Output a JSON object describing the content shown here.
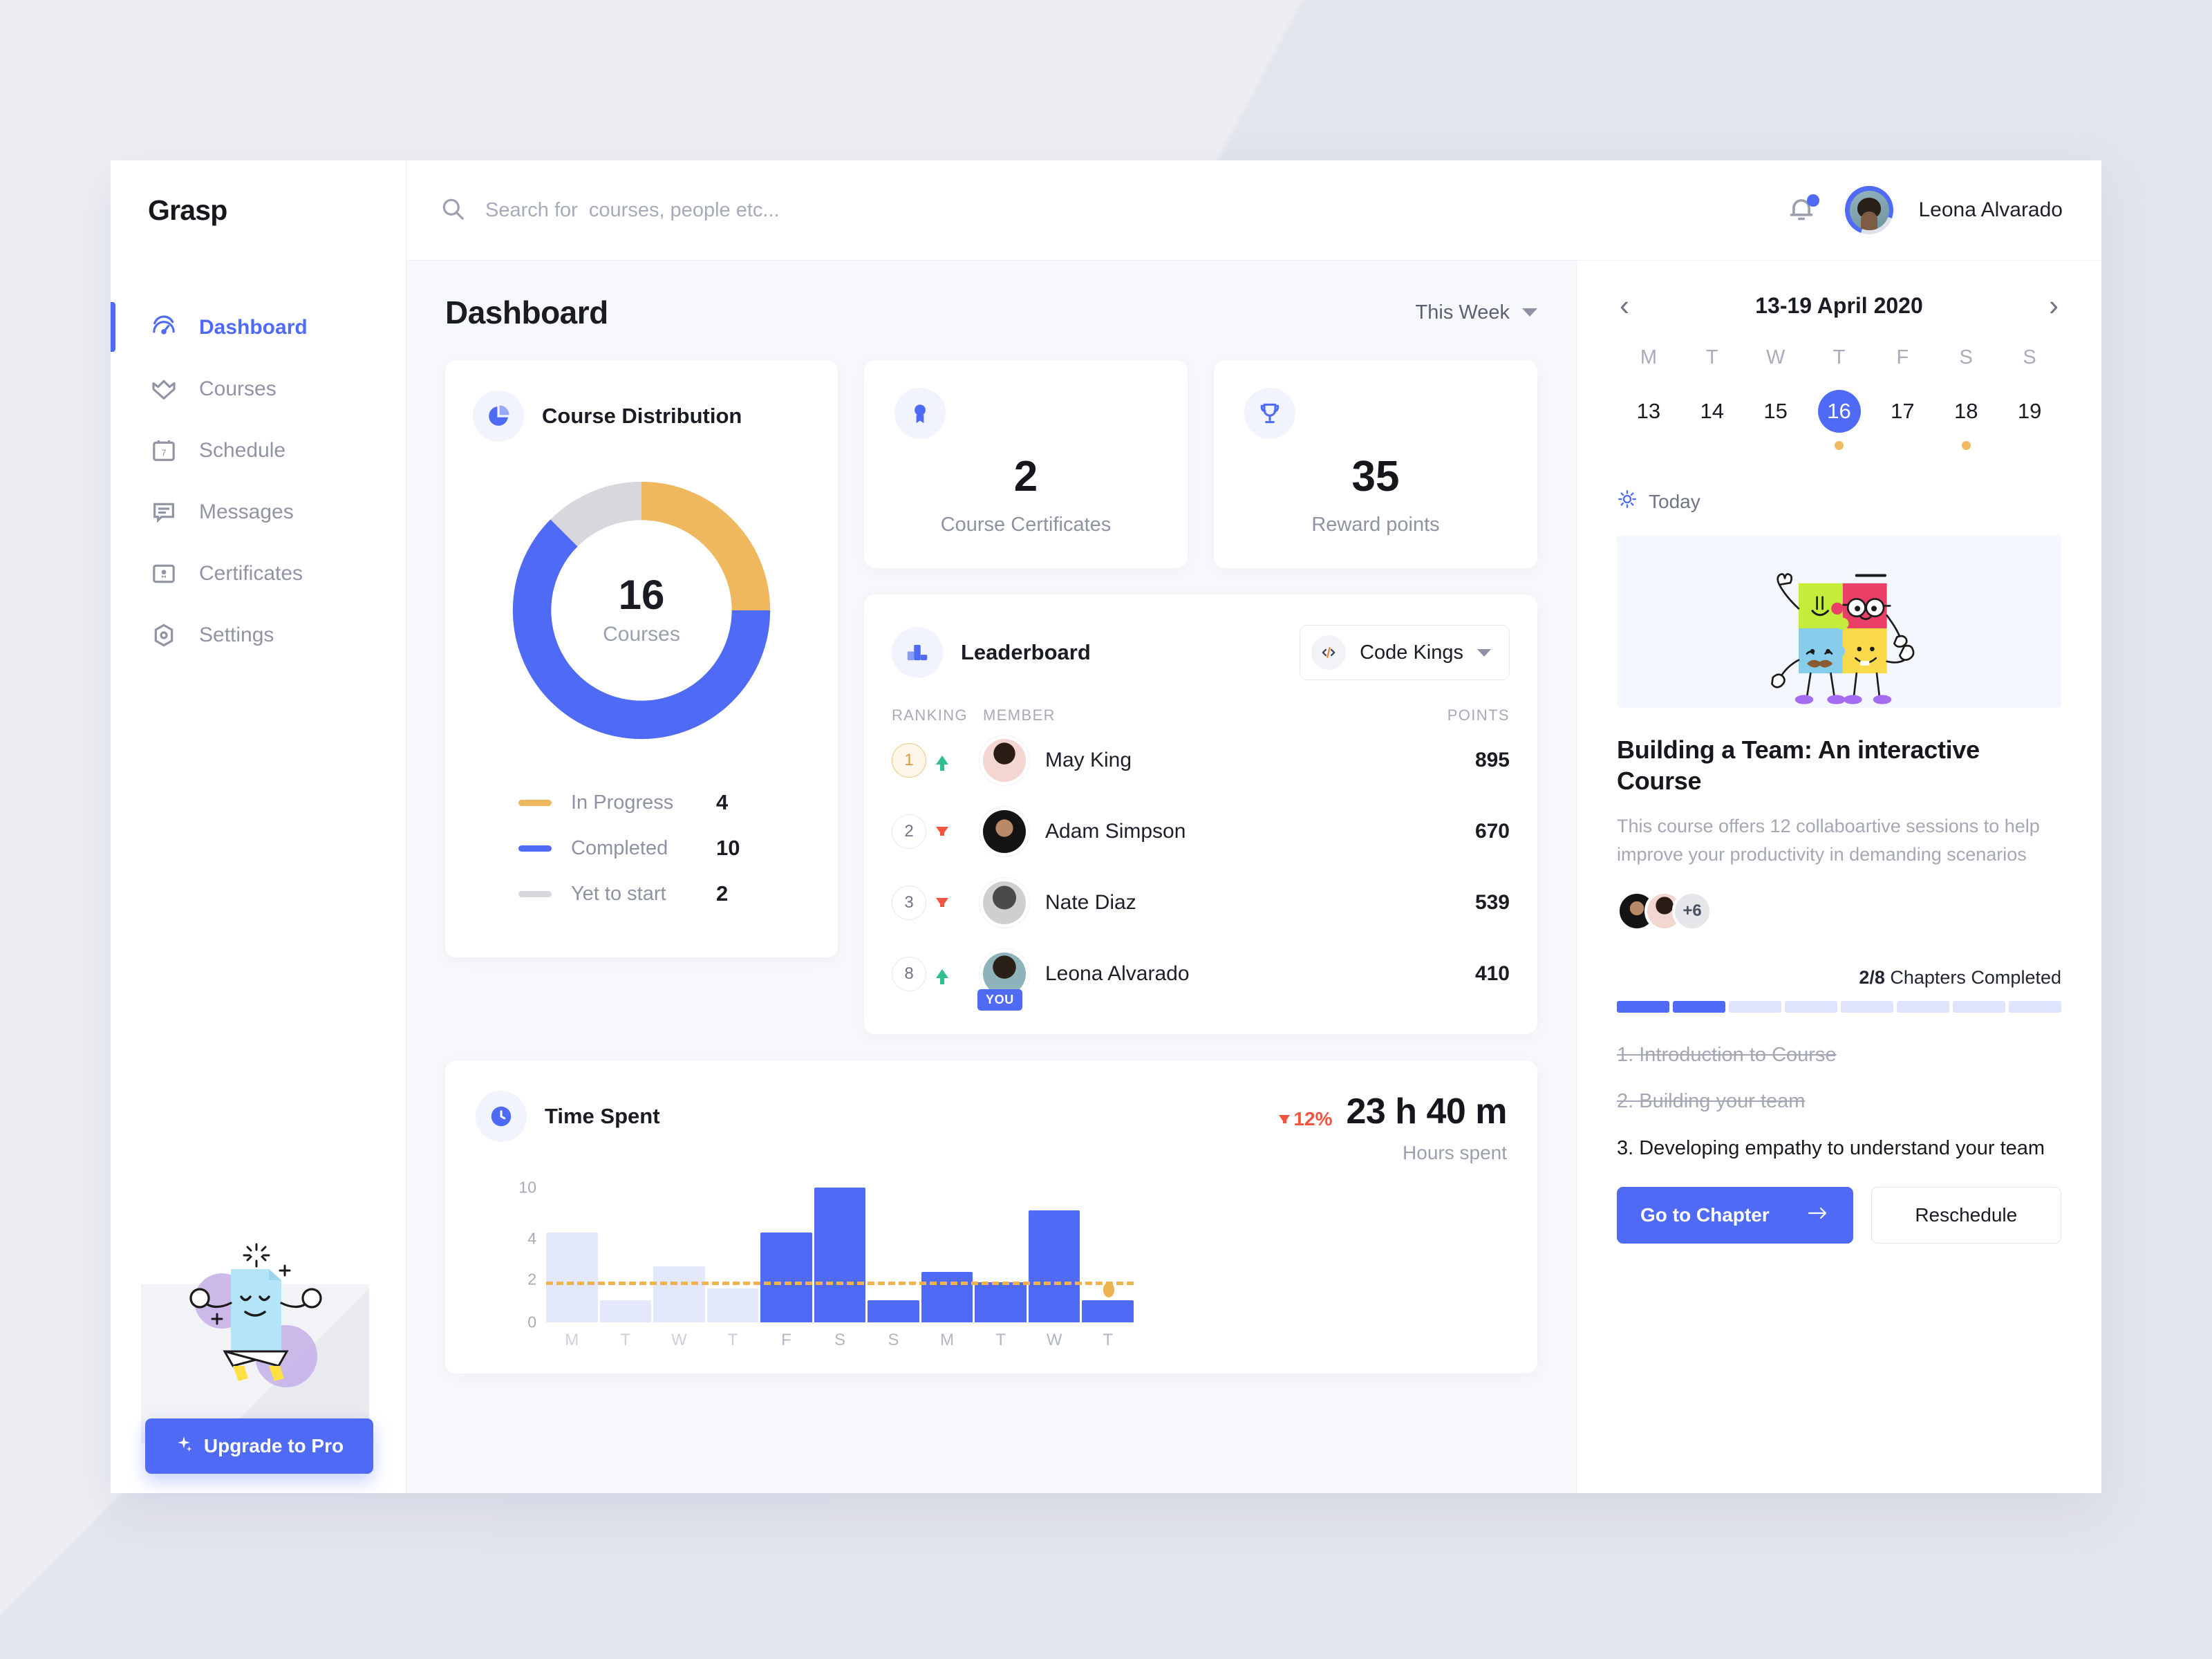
{
  "brand": "Grasp",
  "sidebar": {
    "items": [
      {
        "label": "Dashboard",
        "icon": "dashboard-icon",
        "active": true
      },
      {
        "label": "Courses",
        "icon": "courses-icon",
        "active": false
      },
      {
        "label": "Schedule",
        "icon": "calendar-icon",
        "active": false
      },
      {
        "label": "Messages",
        "icon": "message-icon",
        "active": false
      },
      {
        "label": "Certificates",
        "icon": "certificate-icon",
        "active": false
      },
      {
        "label": "Settings",
        "icon": "settings-icon",
        "active": false
      }
    ],
    "upgrade_label": "Upgrade to Pro",
    "upgrade_icon": "sparkle-icon"
  },
  "topbar": {
    "search_placeholder": "Search for  courses, people etc...",
    "search_value": "",
    "search_icon": "search-icon",
    "bell_icon": "notification-bell-icon",
    "has_notification": true,
    "user_name": "Leona Alvarado"
  },
  "board": {
    "title": "Dashboard",
    "range_label": "This Week"
  },
  "distribution": {
    "title": "Course Distribution",
    "icon": "pie-chart-icon",
    "total": "16",
    "total_label": "Courses",
    "legend": [
      {
        "name": "In Progress",
        "value": "4",
        "color": "#efb85e"
      },
      {
        "name": "Completed",
        "value": "10",
        "color": "#4f6bf6"
      },
      {
        "name": "Yet to start",
        "value": "2",
        "color": "#d6d8dd"
      }
    ]
  },
  "stats": [
    {
      "icon": "certificate-badge-icon",
      "value": "2",
      "label": "Course Certificates"
    },
    {
      "icon": "trophy-icon",
      "value": "35",
      "label": "Reward points"
    }
  ],
  "leaderboard": {
    "title": "Leaderboard",
    "icon": "leaderboard-icon",
    "team": "Code Kings",
    "team_icon": "code-icon",
    "columns": {
      "ranking": "RANKING",
      "member": "MEMBER",
      "points": "POINTS"
    },
    "rows": [
      {
        "rank": "1",
        "trend": "up",
        "name": "May King",
        "points": "895",
        "you": false,
        "gold": true
      },
      {
        "rank": "2",
        "trend": "down",
        "name": "Adam Simpson",
        "points": "670",
        "you": false,
        "gold": false
      },
      {
        "rank": "3",
        "trend": "down",
        "name": "Nate Diaz",
        "points": "539",
        "you": false,
        "gold": false
      },
      {
        "rank": "8",
        "trend": "up",
        "name": "Leona Alvarado",
        "points": "410",
        "you": true,
        "you_label": "YOU",
        "gold": false
      }
    ]
  },
  "time_spent": {
    "title": "Time Spent",
    "icon": "clock-icon",
    "delta": "12%",
    "delta_direction": "down",
    "hours": "23 h 40 m",
    "sub": "Hours spent"
  },
  "chart_data": {
    "type": "bar",
    "title": "Time Spent",
    "categories": [
      "M",
      "T",
      "W",
      "T",
      "F",
      "S",
      "S",
      "M",
      "T",
      "W",
      "T"
    ],
    "values": [
      8,
      2,
      5,
      3,
      8,
      12,
      2,
      4.5,
      3.6,
      10,
      2
    ],
    "series": [
      {
        "name": "Hours spent",
        "values": [
          8,
          2,
          5,
          3,
          8,
          12,
          2,
          4.5,
          3.6,
          10,
          2
        ]
      }
    ],
    "past_count": 4,
    "average_line": 3.3,
    "ylabel": "",
    "xlabel": "",
    "yticks": [
      "0",
      "2",
      "4",
      "10"
    ],
    "ylim": [
      0,
      12
    ],
    "grid": false,
    "legend": "none",
    "colors": {
      "active": "#4f6bf6",
      "past": "#e4e8fd",
      "average": "#efb350"
    }
  },
  "calendar": {
    "range": "13-19 April 2020",
    "prev_icon": "chevron-left-icon",
    "next_icon": "chevron-right-icon",
    "dows": [
      "M",
      "T",
      "W",
      "T",
      "F",
      "S",
      "S"
    ],
    "days": [
      {
        "n": "13",
        "selected": false,
        "event": false
      },
      {
        "n": "14",
        "selected": false,
        "event": false
      },
      {
        "n": "15",
        "selected": false,
        "event": false
      },
      {
        "n": "16",
        "selected": true,
        "event": true
      },
      {
        "n": "17",
        "selected": false,
        "event": false
      },
      {
        "n": "18",
        "selected": false,
        "event": true
      },
      {
        "n": "19",
        "selected": false,
        "event": false
      }
    ],
    "today_label": "Today",
    "today_icon": "sun-icon"
  },
  "course": {
    "hero_icon": "team-puzzle-illustration",
    "title": "Building a Team: An interactive Course",
    "description": "This course offers 12 collaboartive sessions to help improve your productivity in demanding scenarios",
    "more_members": "+6",
    "chapters_completed_count": "2/8",
    "chapters_completed_label": " Chapters Completed",
    "progress_total": 8,
    "progress_done": 2,
    "chapters": [
      {
        "text": "1. Introduction to Course",
        "done": true
      },
      {
        "text": "2. Building your team",
        "done": true
      },
      {
        "text": "3. Developing empathy to   understand your team",
        "done": false
      }
    ],
    "primary_button": "Go to Chapter",
    "primary_button_icon": "arrow-right-icon",
    "secondary_button": "Reschedule"
  },
  "colors": {
    "accent": "#4f6bf6",
    "warning": "#efb85e",
    "danger": "#f1553f",
    "success": "#2fbf91",
    "muted": "#d6d8dd",
    "page_bg": "#e7e8ee",
    "card_bg": "#ffffff"
  }
}
